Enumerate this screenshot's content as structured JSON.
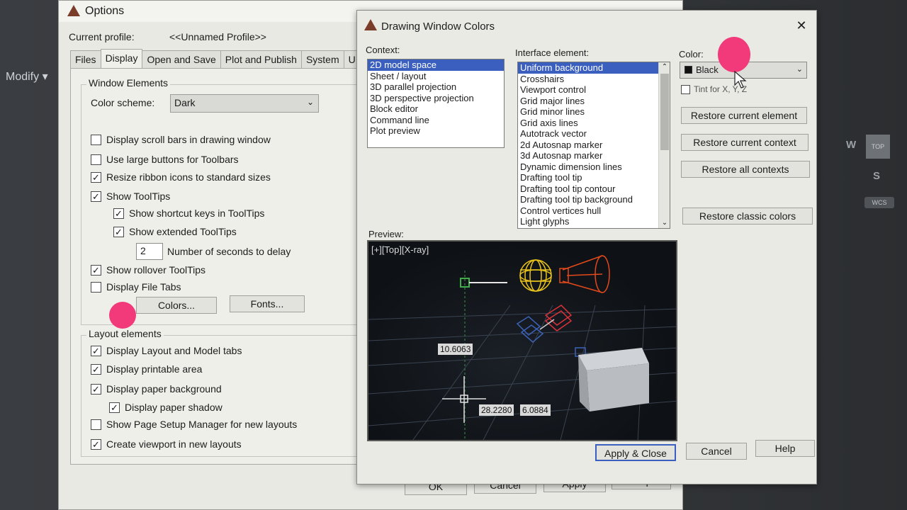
{
  "background_app": {
    "ribbon_item": "Modify",
    "viewcube": {
      "west": "W",
      "south": "S",
      "face": "TOP",
      "wcs": "WCS"
    }
  },
  "options_dialog": {
    "title": "Options",
    "current_profile_label": "Current profile:",
    "current_profile_value": "<<Unnamed Profile>>",
    "tabs": [
      "Files",
      "Display",
      "Open and Save",
      "Plot and Publish",
      "System",
      "U"
    ],
    "active_tab": "Display",
    "window_elements": {
      "title": "Window Elements",
      "color_scheme_label": "Color scheme:",
      "color_scheme_value": "Dark",
      "checkboxes": [
        {
          "label": "Display scroll bars in drawing window",
          "checked": false
        },
        {
          "label": "Use large buttons for Toolbars",
          "checked": false
        },
        {
          "label": "Resize ribbon icons to standard sizes",
          "checked": true
        },
        {
          "label": "Show ToolTips",
          "checked": true
        },
        {
          "label": "Show shortcut keys in ToolTips",
          "checked": true
        },
        {
          "label": "Show extended ToolTips",
          "checked": true
        }
      ],
      "delay_value": "2",
      "delay_label": "Number of seconds to delay",
      "checkboxes_after": [
        {
          "label": "Show rollover ToolTips",
          "checked": true
        },
        {
          "label": "Display File Tabs",
          "checked": false
        }
      ],
      "colors_button": "Colors...",
      "fonts_button": "Fonts..."
    },
    "layout_elements": {
      "title": "Layout elements",
      "checkboxes": [
        {
          "label": "Display Layout and Model tabs",
          "checked": true
        },
        {
          "label": "Display printable area",
          "checked": true
        },
        {
          "label": "Display paper background",
          "checked": true
        },
        {
          "label": "Display paper shadow",
          "checked": true
        },
        {
          "label": "Show Page Setup Manager for new layouts",
          "checked": false
        },
        {
          "label": "Create viewport in new layouts",
          "checked": true
        }
      ]
    },
    "buttons": {
      "ok": "OK",
      "cancel": "Cancel",
      "apply": "Apply",
      "help": "Help"
    }
  },
  "dwc_dialog": {
    "title": "Drawing Window Colors",
    "close": "✕",
    "context_label": "Context:",
    "contexts": [
      "2D model space",
      "Sheet / layout",
      "3D parallel projection",
      "3D perspective projection",
      "Block editor",
      "Command line",
      "Plot preview"
    ],
    "selected_context": "2D model space",
    "interface_label": "Interface element:",
    "interface_elements": [
      "Uniform background",
      "Crosshairs",
      "Viewport control",
      "Grid major lines",
      "Grid minor lines",
      "Grid axis lines",
      "Autotrack vector",
      "2d Autosnap marker",
      "3d Autosnap marker",
      "Dynamic dimension lines",
      "Drafting tool tip",
      "Drafting tool tip contour",
      "Drafting tool tip background",
      "Control vertices hull",
      "Light glyphs"
    ],
    "selected_interface": "Uniform background",
    "color_label": "Color:",
    "color_value": "Black",
    "tint_label": "Tint for X, Y, Z",
    "tint_checked": false,
    "restore_current_element": "Restore current element",
    "restore_current_context": "Restore current context",
    "restore_all_contexts": "Restore all contexts",
    "restore_classic_colors": "Restore classic colors",
    "preview_label": "Preview:",
    "preview": {
      "viewport_label": "[+][Top][X-ray]",
      "dim_value": "10.6063",
      "coord_x": "28.2280",
      "coord_y": "6.0884"
    },
    "buttons": {
      "apply_close": "Apply & Close",
      "cancel": "Cancel",
      "help": "Help"
    }
  },
  "colors": {
    "highlight": "#3b5fbf",
    "marker": "#f2397a",
    "preview_bg": "#0e1115"
  }
}
